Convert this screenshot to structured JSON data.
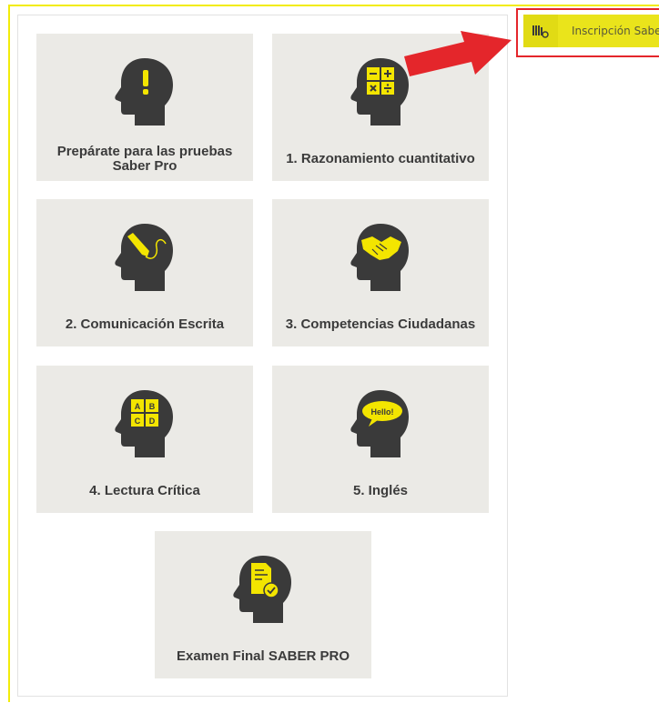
{
  "cards": [
    {
      "label": "Prepárate para las pruebas Saber Pro",
      "icon": "exclamation-head-icon"
    },
    {
      "label": "1. Razonamiento cuantitativo",
      "icon": "math-operators-head-icon"
    },
    {
      "label": "2. Comunicación Escrita",
      "icon": "pen-writing-head-icon"
    },
    {
      "label": "3. Competencias Ciudadanas",
      "icon": "handshake-head-icon"
    },
    {
      "label": "4. Lectura Crítica",
      "icon": "abcd-grid-head-icon"
    },
    {
      "label": "5. Inglés",
      "icon": "hello-speech-bubble-head-icon"
    },
    {
      "label": "Examen Final SABER PRO",
      "icon": "document-check-head-icon"
    }
  ],
  "register": {
    "label": "Inscripción Saber Pro",
    "icon": "id-card-icon"
  },
  "icon_grid_letters": [
    "A",
    "B",
    "C",
    "D"
  ],
  "hello_text": "Hello!",
  "colors": {
    "accent_yellow": "#f3e500",
    "card_bg": "#ebeae6",
    "head_dark": "#3a3a3a",
    "highlight_red": "#e4262b"
  }
}
